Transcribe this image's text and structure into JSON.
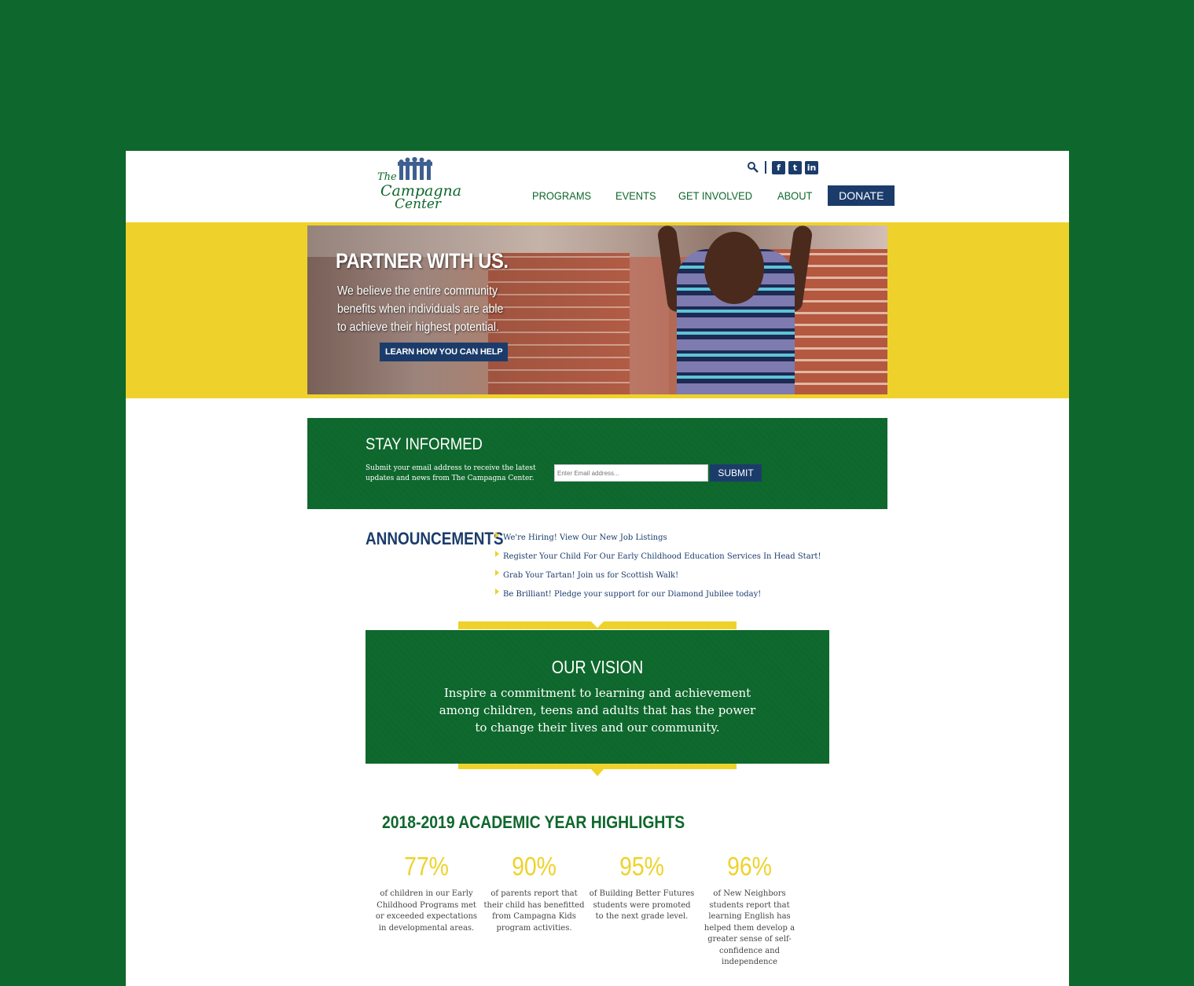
{
  "logo": {
    "line1": "The",
    "line2": "Campagna",
    "line3": "Center"
  },
  "utility": {
    "social": [
      {
        "icon": "facebook-icon",
        "glyph": "f"
      },
      {
        "icon": "twitter-icon",
        "glyph": "t"
      },
      {
        "icon": "linkedin-icon",
        "glyph": "in"
      }
    ]
  },
  "nav": {
    "items": [
      "PROGRAMS",
      "EVENTS",
      "GET INVOLVED",
      "ABOUT"
    ],
    "donate": "DONATE"
  },
  "hero": {
    "title": "PARTNER WITH US.",
    "subtitle": "We believe the entire community benefits when individuals are able to achieve their highest potential.",
    "cta": "LEARN HOW YOU CAN HELP"
  },
  "stay": {
    "title": "STAY INFORMED",
    "text": "Submit your email address to receive the latest updates and news from The Campagna Center.",
    "placeholder": "Enter Email address...",
    "submit": "SUBMIT"
  },
  "announcements": {
    "title": "ANNOUNCEMENTS",
    "items": [
      "We're Hiring! View Our New Job Listings",
      "Register Your Child For Our Early Childhood Education Services In Head Start!",
      "Grab Your Tartan! Join us for Scottish Walk!",
      "Be Brilliant! Pledge your support for our Diamond Jubilee today!"
    ]
  },
  "vision": {
    "title": "OUR VISION",
    "text": "Inspire a commitment to learning and achievement among children, teens and adults that has the power to change their lives and our community."
  },
  "highlights": {
    "title": "2018-2019 ACADEMIC YEAR HIGHLIGHTS",
    "stats": [
      {
        "value": "77%",
        "text": "of children in our Early Childhood Programs met or exceeded expectations in developmental areas."
      },
      {
        "value": "90%",
        "text": "of parents report that their child has benefitted from Campagna Kids program activities."
      },
      {
        "value": "95%",
        "text": "of Building Better Futures students were promoted to the next grade level."
      },
      {
        "value": "96%",
        "text": "of New Neighbors students report that learning English has helped them develop a greater sense of self-confidence and independence"
      }
    ]
  },
  "colors": {
    "green": "#0e672c",
    "yellow": "#eed22b",
    "navy": "#1b3c6b"
  }
}
